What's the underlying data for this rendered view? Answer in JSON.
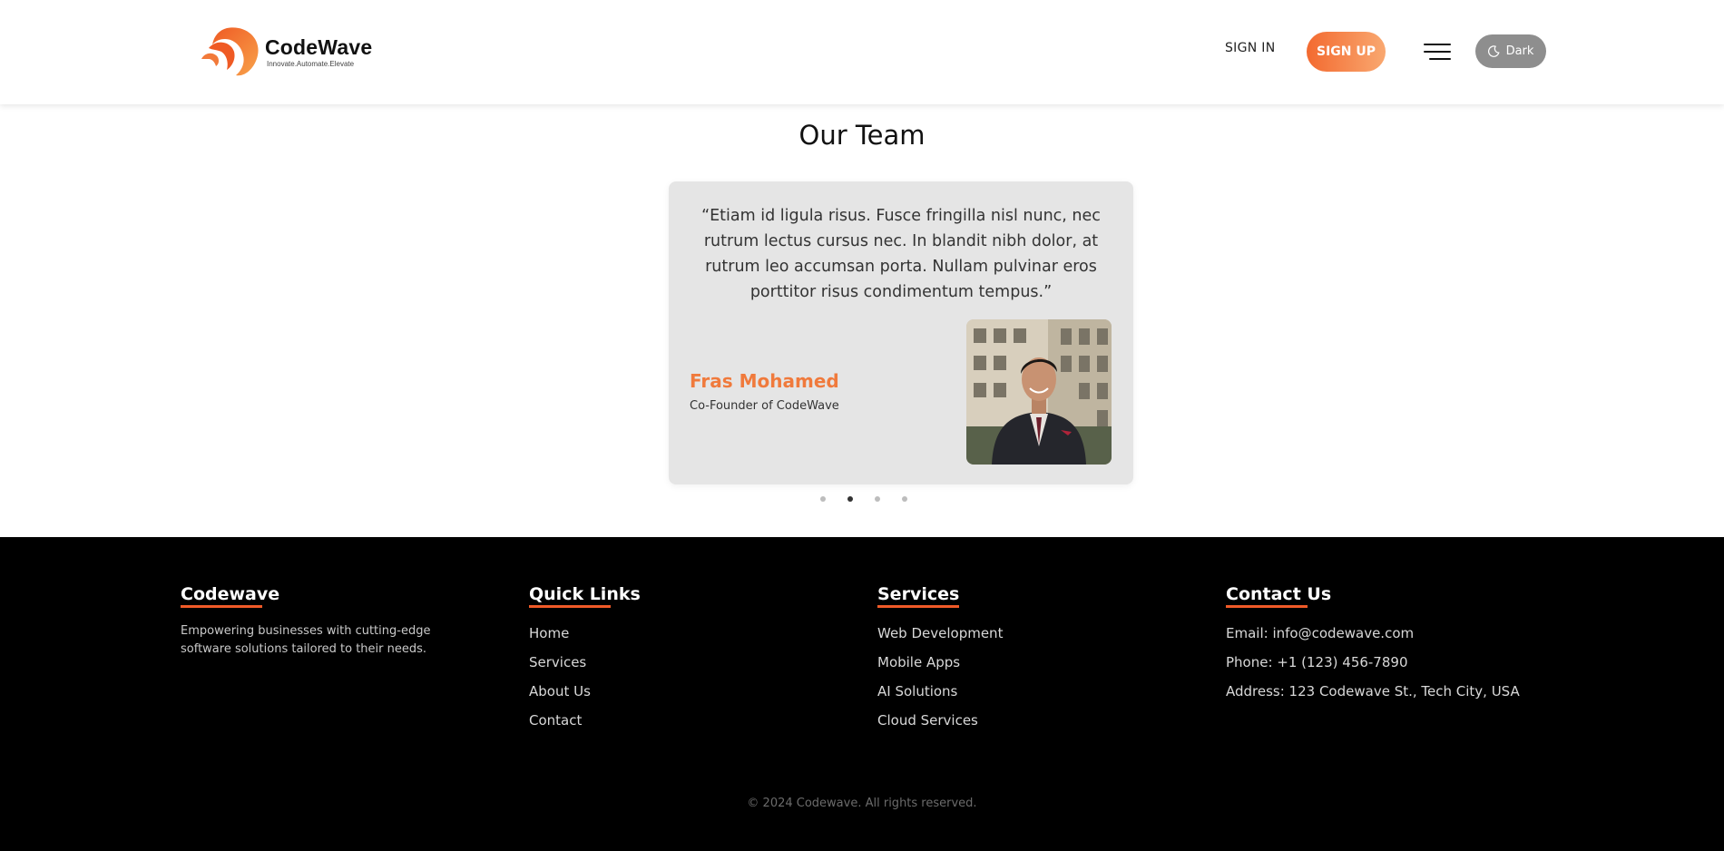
{
  "header": {
    "logo_name": "CodeWave",
    "logo_tagline": "Innovate.Automate.Elevate",
    "signin_label": "SIGN IN",
    "signup_label": "SIGN UP",
    "theme_toggle_label": "Dark",
    "brand_color": "#f36a30"
  },
  "team": {
    "title": "Our Team",
    "quote": "“Etiam id ligula risus. Fusce fringilla nisl nunc, nec rutrum lectus cursus nec. In blandit nibh dolor, at rutrum leo accumsan porta. Nullam pulvinar eros porttitor risus condimentum tempus.”",
    "member_name": "Fras Mohamed",
    "member_role": "Co-Founder of CodeWave",
    "slide_count": 4,
    "active_slide": 2
  },
  "footer": {
    "about": {
      "heading": "Codewave",
      "description": "Empowering businesses with cutting-edge software solutions tailored to their needs."
    },
    "quick_links": {
      "heading": "Quick Links",
      "items": [
        "Home",
        "Services",
        "About Us",
        "Contact"
      ]
    },
    "services": {
      "heading": "Services",
      "items": [
        "Web Development",
        "Mobile Apps",
        "AI Solutions",
        "Cloud Services"
      ]
    },
    "contact": {
      "heading": "Contact Us",
      "email": "Email: info@codewave.com",
      "phone": "Phone: +1 (123) 456-7890",
      "address": "Address: 123 Codewave St., Tech City, USA"
    },
    "copyright": "© 2024 Codewave. All rights reserved.",
    "accent_color": "#f05a28"
  }
}
